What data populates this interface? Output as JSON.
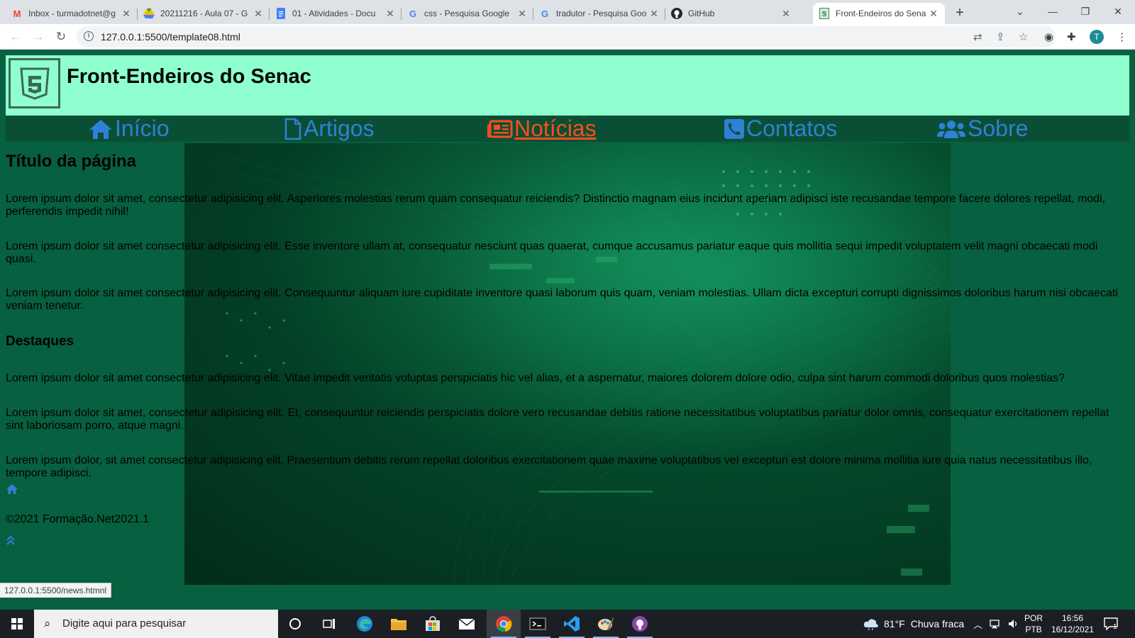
{
  "browser": {
    "tabs": [
      {
        "title": "Inbox - turmadotnet@g",
        "icon": "gmail-icon",
        "color": "#ea4335",
        "glyph": "M"
      },
      {
        "title": "20211216 - Aula 07 - G",
        "icon": "drive-icon",
        "color": "#34a853",
        "glyph": "▲"
      },
      {
        "title": "01 - Atividades - Docu",
        "icon": "docs-icon",
        "color": "#4285f4",
        "glyph": "≡"
      },
      {
        "title": "css - Pesquisa Google",
        "icon": "google-icon",
        "color": "#4285f4",
        "glyph": "G"
      },
      {
        "title": "tradutor - Pesquisa Goo",
        "icon": "google-icon",
        "color": "#4285f4",
        "glyph": "G"
      },
      {
        "title": "GitHub",
        "icon": "github-icon",
        "color": "#24292f",
        "glyph": "●"
      },
      {
        "title": "Front-Endeiros do Sena",
        "icon": "html5-icon",
        "color": "#3b8f5a",
        "glyph": "5",
        "active": true
      }
    ],
    "url": "127.0.0.1:5500/template08.html",
    "profile_initial": "T",
    "status_url": "127.0.0.1:5500/news.htmnl"
  },
  "site": {
    "title": "Front-Endeiros do Senac",
    "nav": [
      {
        "label": "Início",
        "icon": "home-icon"
      },
      {
        "label": "Artigos",
        "icon": "file-icon"
      },
      {
        "label": "Notícias",
        "icon": "newspaper-icon",
        "active": true
      },
      {
        "label": "Contatos",
        "icon": "phone-icon"
      },
      {
        "label": "Sobre",
        "icon": "users-icon"
      }
    ],
    "page_title": "Título da página",
    "paragraphs": [
      "Lorem ipsum dolor sit amet, consectetur adipisicing elit. Asperiores molestias rerum quam consequatur reiciendis? Distinctio magnam eius incidunt aperiam adipisci iste recusandae tempore facere dolores repellat, modi, perferendis impedit nihil!",
      "Lorem ipsum dolor sit amet consectetur adipisicing elit. Esse inventore ullam at, consequatur nesciunt quas quaerat, cumque accusamus pariatur eaque quis mollitia sequi impedit voluptatem velit magni obcaecati modi quasi.",
      "Lorem ipsum dolor sit amet consectetur adipisicing elit. Consequuntur aliquam iure cupiditate inventore quasi laborum quis quam, veniam molestias. Ullam dicta excepturi corrupti dignissimos doloribus harum nisi obcaecati veniam tenetur."
    ],
    "highlights_title": "Destaques",
    "highlights": [
      "Lorem ipsum dolor sit amet consectetur adipisicing elit. Vitae impedit veritatis voluptas perspiciatis hic vel alias, et a aspernatur, maiores dolorem dolore odio, culpa sint harum commodi doloribus quos molestias?",
      "Lorem ipsum dolor sit amet, consectetur adipisicing elit. Et, consequuntur reiciendis perspiciatis dolore vero recusandae debitis ratione necessitatibus voluptatibus pariatur dolor omnis, consequatur exercitationem repellat sint laboriosam porro, atque magni.",
      "Lorem ipsum dolor, sit amet consectetur adipisicing elit. Praesentium debitis rerum repellat doloribus exercitationem quae maxime voluptatibus vel excepturi est dolore minima mollitia iure quia natus necessitatibus illo, tempore adipisci."
    ],
    "copyright": "©2021 Formação.Net2021.1"
  },
  "taskbar": {
    "search_placeholder": "Digite aqui para pesquisar",
    "weather_temp": "81°F",
    "weather_desc": "Chuva fraca",
    "lang_top": "POR",
    "lang_bottom": "PTB",
    "time": "16:56",
    "date": "16/12/2021",
    "notifications": "1"
  },
  "colors": {
    "page_bg": "#07603f",
    "header_bg": "#8fffcf",
    "nav_link": "#2f80d6",
    "nav_active": "#ff4d1a"
  }
}
